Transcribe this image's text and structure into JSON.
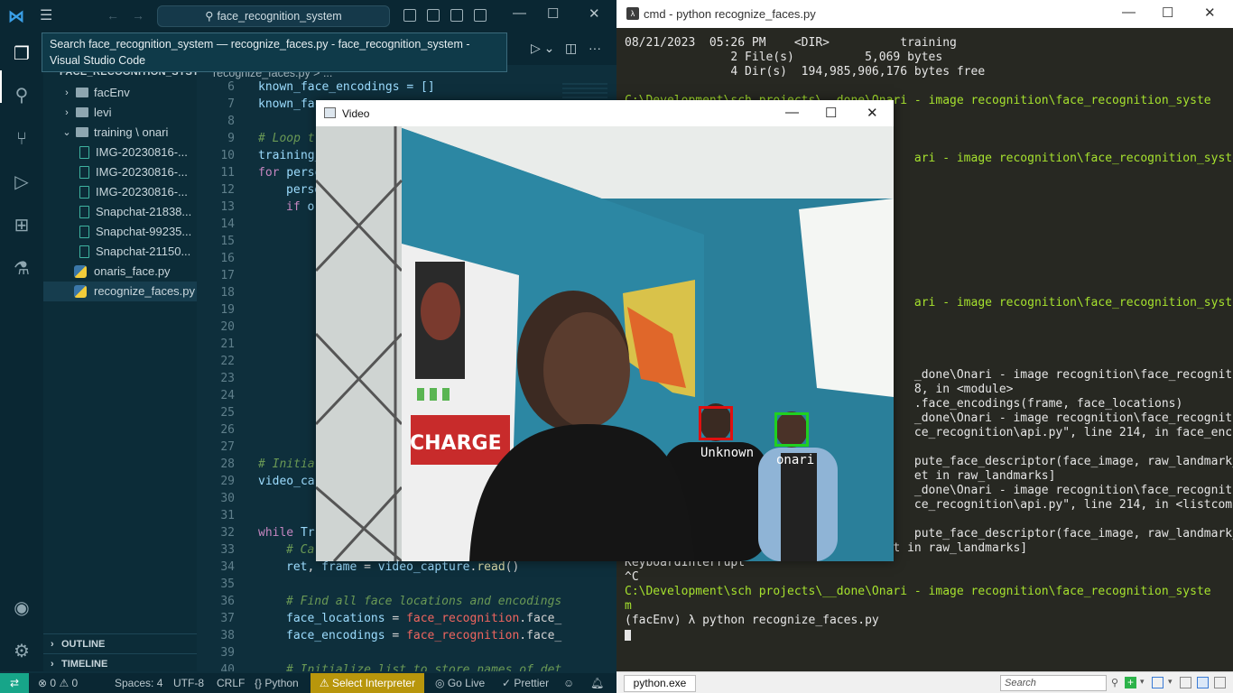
{
  "vscode": {
    "search_text": "face_recognition_system",
    "tooltip": "Search face_recognition_system — recognize_faces.py - face_recognition_system - Visual Studio Code",
    "explorer_header": "FACE_RECOGNITION_SYST...",
    "breadcrumb": "recognize_faces.py > ...",
    "tree": [
      {
        "label": "facEnv",
        "type": "folder",
        "expanded": false
      },
      {
        "label": "levi",
        "type": "folder",
        "expanded": false
      },
      {
        "label": "training \\ onari",
        "type": "folder",
        "expanded": true
      },
      {
        "label": "IMG-20230816-...",
        "type": "image"
      },
      {
        "label": "IMG-20230816-...",
        "type": "image"
      },
      {
        "label": "IMG-20230816-...",
        "type": "image"
      },
      {
        "label": "Snapchat-21838...",
        "type": "image"
      },
      {
        "label": "Snapchat-99235...",
        "type": "image"
      },
      {
        "label": "Snapchat-21150...",
        "type": "image"
      },
      {
        "label": "onaris_face.py",
        "type": "python"
      },
      {
        "label": "recognize_faces.py",
        "type": "python",
        "selected": true
      }
    ],
    "outline_label": "OUTLINE",
    "timeline_label": "TIMELINE",
    "line_numbers": [
      "6",
      "7",
      "8",
      "9",
      "10",
      "11",
      "12",
      "13",
      "14",
      "15",
      "16",
      "17",
      "18",
      "19",
      "20",
      "21",
      "22",
      "23",
      "24",
      "25",
      "26",
      "27",
      "28",
      "29",
      "30",
      "31",
      "32",
      "33",
      "34",
      "35",
      "36",
      "37",
      "38",
      "39",
      "40"
    ],
    "code": {
      "l6": "known_face_encodings = []",
      "l7": "known_fac",
      "l9": "# Loop t",
      "l10": "training_",
      "l11a": "for",
      "l11b": " perso",
      "l12": "perso",
      "l13a": "if",
      "l13b": " o",
      "l28": "# Initia",
      "l29": "video_ca",
      "l32a": "while",
      "l32b": " Tr",
      "l33": "# Ca",
      "l34a": "ret",
      "l34b": ", ",
      "l34c": "frame",
      "l34d": " = ",
      "l34e": "video_capture",
      "l34f": ".",
      "l34g": "read",
      "l34h": "()",
      "l36": "# Find all face locations and encodings",
      "l37a": "face_locations",
      "l37b": " = ",
      "l37c": "face_recognition",
      "l37d": ".face_",
      "l38a": "face_encodings",
      "l38b": " = ",
      "l38c": "face_recognition",
      "l38d": ".face_",
      "l40": "# Initialize list to store names of det"
    },
    "status": {
      "errors": "0",
      "warnings": "0",
      "spaces": "Spaces: 4",
      "encoding": "UTF-8",
      "eol": "CRLF",
      "language": "Python",
      "interpreter": "Select Interpreter",
      "golive": "Go Live",
      "prettier": "Prettier"
    }
  },
  "cmd": {
    "title": "cmd - python  recognize_faces.py",
    "lines": [
      {
        "text": "08/21/2023  05:26 PM    <DIR>          training",
        "color": "w"
      },
      {
        "text": "               2 File(s)          5,069 bytes",
        "color": "w"
      },
      {
        "text": "               4 Dir(s)  194,985,906,176 bytes free",
        "color": "w"
      },
      {
        "text": "",
        "color": "w"
      },
      {
        "text": "C:\\Development\\sch projects\\__done\\Onari - image recognition\\face_recognition_syste",
        "color": "g"
      },
      {
        "text": "",
        "color": "w"
      },
      {
        "text": "",
        "color": "w"
      },
      {
        "text": "",
        "color": "w"
      },
      {
        "text": "                                         ari - image recognition\\face_recognition_syste",
        "color": "g"
      },
      {
        "text": "",
        "color": "w"
      },
      {
        "text": "",
        "color": "w"
      },
      {
        "text": "",
        "color": "w"
      },
      {
        "text": "",
        "color": "w"
      },
      {
        "text": "",
        "color": "w"
      },
      {
        "text": "",
        "color": "w"
      },
      {
        "text": "",
        "color": "w"
      },
      {
        "text": "",
        "color": "w"
      },
      {
        "text": "",
        "color": "w"
      },
      {
        "text": "                                         ari - image recognition\\face_recognition_syste",
        "color": "g"
      },
      {
        "text": "",
        "color": "w"
      },
      {
        "text": "",
        "color": "w"
      },
      {
        "text": "",
        "color": "w"
      },
      {
        "text": "",
        "color": "w"
      },
      {
        "text": "                                         _done\\Onari - image recognition\\face_recogniti",
        "color": "w"
      },
      {
        "text": "                                         8, in <module>",
        "color": "w"
      },
      {
        "text": "                                         .face_encodings(frame, face_locations)",
        "color": "w"
      },
      {
        "text": "                                         _done\\Onari - image recognition\\face_recogniti",
        "color": "w"
      },
      {
        "text": "                                         ce_recognition\\api.py\", line 214, in face_enco",
        "color": "w"
      },
      {
        "text": "",
        "color": "w"
      },
      {
        "text": "                                         pute_face_descriptor(face_image, raw_landmark_",
        "color": "w"
      },
      {
        "text": "                                         et in raw_landmarks]",
        "color": "w"
      },
      {
        "text": "                                         _done\\Onari - image recognition\\face_recogniti",
        "color": "w"
      },
      {
        "text": "                                         ce_recognition\\api.py\", line 214, in <listcomp",
        "color": "w"
      },
      {
        "text": "",
        "color": "w"
      },
      {
        "text": "                                         pute_face_descriptor(face_image, raw_landmark_",
        "color": "w"
      },
      {
        "text": "set, num_jitters)) for raw_landmark_set in raw_landmarks]",
        "color": "w"
      },
      {
        "text": "KeyboardInterrupt",
        "color": "w"
      },
      {
        "text": "^C",
        "color": "w"
      },
      {
        "text": "C:\\Development\\sch projects\\__done\\Onari - image recognition\\face_recognition_syste",
        "color": "g"
      },
      {
        "text": "m",
        "color": "g"
      },
      {
        "text": "(facEnv) λ python recognize_faces.py",
        "color": "w"
      }
    ],
    "status_tab": "python.exe",
    "search_placeholder": "Search"
  },
  "video": {
    "title": "Video",
    "faces": [
      {
        "label": "Unknown",
        "box_color": "#e01010"
      },
      {
        "label": "onari",
        "box_color": "#20d020"
      }
    ],
    "poster_text": "CHARGE"
  },
  "colors": {
    "vscode_bg": "#0e2f3c",
    "cmd_bg": "#272822",
    "cmd_green": "#a6e22e",
    "status_warn": "#b8960c",
    "remote": "#17a589"
  }
}
